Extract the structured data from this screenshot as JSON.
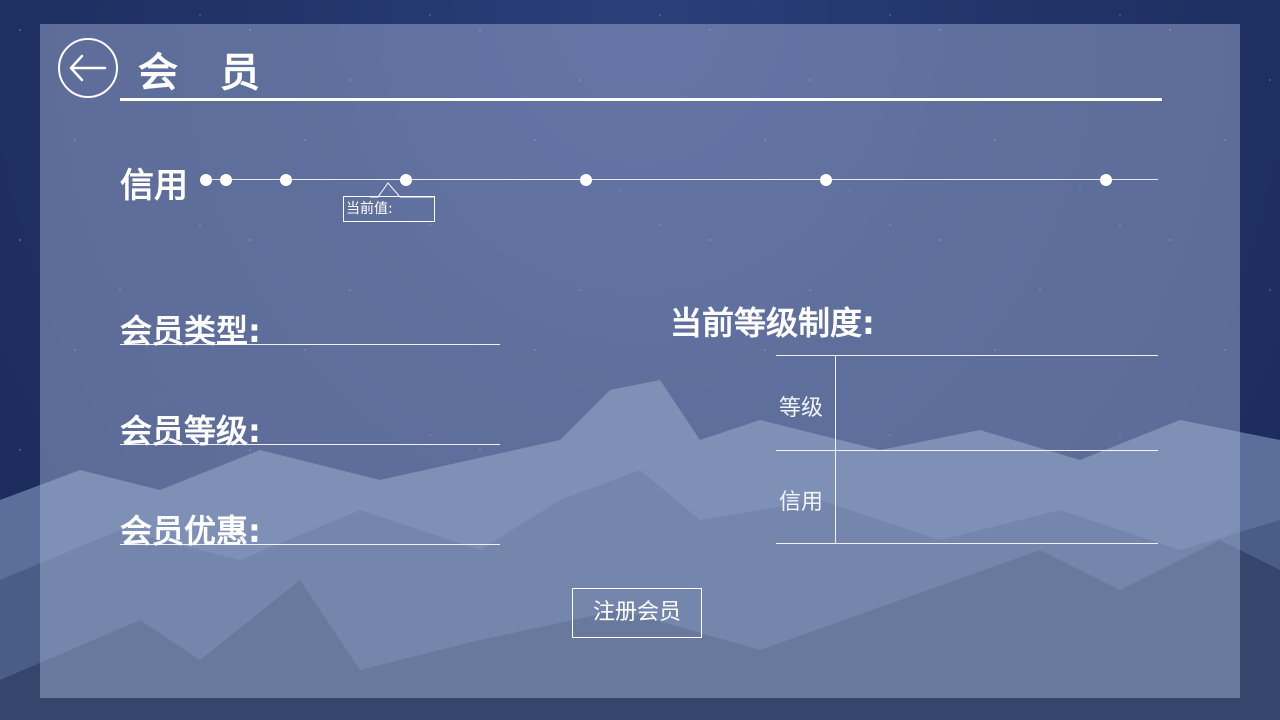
{
  "header": {
    "title": "会 员",
    "back_icon": "arrow-left-icon"
  },
  "credit": {
    "label": "信用",
    "current_value_label": "当前值:",
    "marker_count": 7
  },
  "member_info": {
    "type_label": "会员类型:",
    "level_label": "会员等级:",
    "benefit_label": "会员优惠:"
  },
  "level_system": {
    "title": "当前等级制度:",
    "rows": [
      {
        "label": "等级"
      },
      {
        "label": "信用"
      }
    ]
  },
  "actions": {
    "register_label": "注册会员"
  },
  "colors": {
    "panel_overlay": "#aab9dc",
    "text": "#ffffff",
    "sky": "#22346a"
  }
}
